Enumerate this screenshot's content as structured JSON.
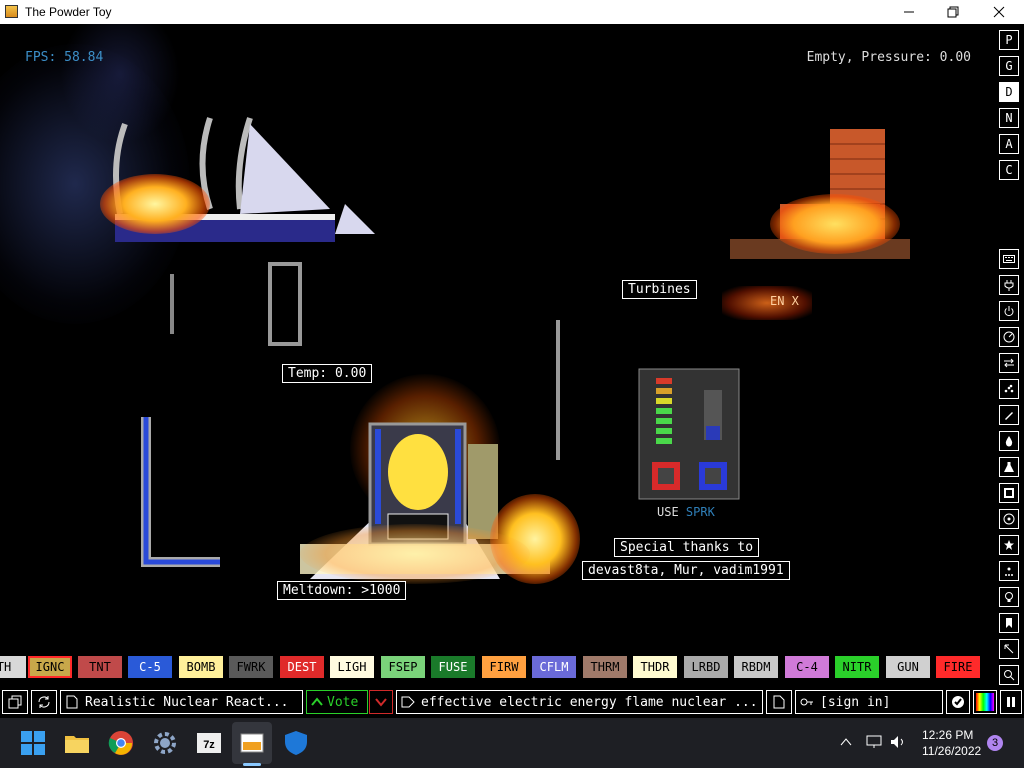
{
  "window": {
    "title": "The Powder Toy"
  },
  "hud": {
    "fps": "FPS: 58.84",
    "status": "Empty, Pressure: 0.00"
  },
  "labels": {
    "turbines": "Turbines",
    "temp": "Temp: 0.00",
    "meltdown": "Meltdown: >1000",
    "thanks_line1": "Special thanks to",
    "thanks_line2": "devast8ta, Mur, vadim1991",
    "use_prefix": "USE",
    "use_spark": "SPRK",
    "en_sign": "EN X"
  },
  "sidebar": {
    "top_buttons": [
      "P",
      "G",
      "D",
      "N",
      "A",
      "C"
    ],
    "active_top": "D",
    "tool_icons": [
      "keyboard-icon",
      "plug-icon",
      "power-icon",
      "gauge-icon",
      "arrows-icon",
      "powder-icon",
      "pen-icon",
      "drop-icon",
      "flask-icon",
      "square-icon",
      "radiation-icon",
      "star-icon",
      "dots-icon",
      "bulb-icon",
      "bookmark-icon",
      "cursor-icon",
      "search-icon",
      "pause-icon"
    ]
  },
  "elements": [
    {
      "label": "TH",
      "color": "#d8d8d8",
      "text": "#000000"
    },
    {
      "label": "IGNC",
      "color": "#c8a84a",
      "text": "#000000",
      "selected": true
    },
    {
      "label": "TNT",
      "color": "#c04a4a",
      "text": "#000000"
    },
    {
      "label": "C-5",
      "color": "#2a5ad8",
      "text": "#ffffff"
    },
    {
      "label": "BOMB",
      "color": "#fff09a",
      "text": "#000000"
    },
    {
      "label": "FWRK",
      "color": "#5a5a5a",
      "text": "#000000"
    },
    {
      "label": "DEST",
      "color": "#e02a2a",
      "text": "#ffffff"
    },
    {
      "label": "LIGH",
      "color": "#fffbe0",
      "text": "#000000"
    },
    {
      "label": "FSEP",
      "color": "#7ad27a",
      "text": "#000000"
    },
    {
      "label": "FUSE",
      "color": "#1a7a2a",
      "text": "#ffffff"
    },
    {
      "label": "FIRW",
      "color": "#ffa040",
      "text": "#000000"
    },
    {
      "label": "CFLM",
      "color": "#6a6ad8",
      "text": "#ffffff"
    },
    {
      "label": "THRM",
      "color": "#a07a6a",
      "text": "#000000"
    },
    {
      "label": "THDR",
      "color": "#fffbd0",
      "text": "#000000"
    },
    {
      "label": "LRBD",
      "color": "#aaaaaa",
      "text": "#000000"
    },
    {
      "label": "RBDM",
      "color": "#c8c8c8",
      "text": "#000000"
    },
    {
      "label": "C-4",
      "color": "#d07ad8",
      "text": "#000000"
    },
    {
      "label": "NITR",
      "color": "#2ad02a",
      "text": "#000000"
    },
    {
      "label": "GUN",
      "color": "#d0d0d0",
      "text": "#000000"
    },
    {
      "label": "FIRE",
      "color": "#ff2a2a",
      "text": "#000000"
    }
  ],
  "gamebar": {
    "save_title": "Realistic Nuclear React...",
    "vote_label": "Vote",
    "tags": "effective electric energy flame nuclear ...",
    "signin": "[sign in]"
  },
  "taskbar": {
    "time": "12:26 PM",
    "date": "11/26/2022",
    "badge": "3"
  },
  "colors": {
    "fps": "#3c8fc8",
    "accent_red": "#ff2a2a"
  }
}
